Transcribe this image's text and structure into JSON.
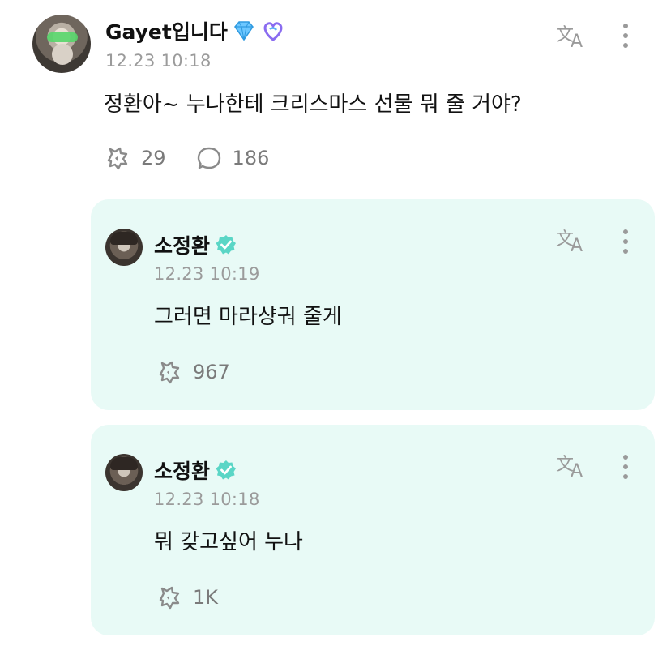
{
  "colors": {
    "reply_background": "#e8faf6",
    "muted_text": "#9b9b9b",
    "icon_gray": "#8a8a8a",
    "verified_badge": "#5ad6c6",
    "heart_badge": "#8a6cf0",
    "diamond_badge": "#6cc7ff"
  },
  "post": {
    "author": "Gayet입니다",
    "author_badges": [
      "diamond-icon",
      "heart-badge-icon"
    ],
    "time": "12.23 10:18",
    "text": "정환아~ 누나한테 크리스마스 선물 뭐 줄 거야?",
    "likes": "29",
    "comments": "186",
    "actions": [
      "translate-icon",
      "more-options-icon"
    ]
  },
  "replies": [
    {
      "author": "소정환",
      "verified": true,
      "time": "12.23 10:19",
      "text": "그러면 마라샹궈 줄게",
      "likes": "967"
    },
    {
      "author": "소정환",
      "verified": true,
      "time": "12.23 10:18",
      "text": "뭐 갖고싶어 누나",
      "likes": "1K"
    }
  ]
}
